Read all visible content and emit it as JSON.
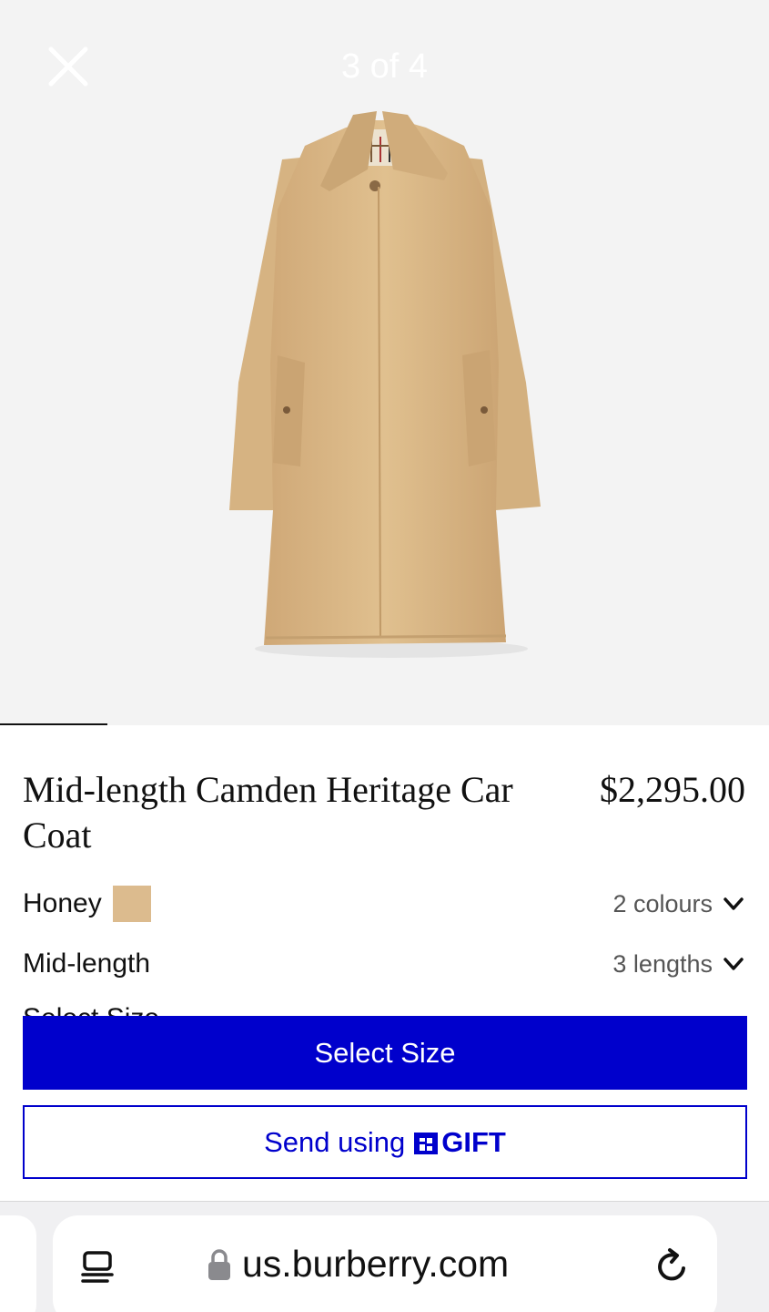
{
  "colors": {
    "accent_blue": "#0000cc",
    "coat": "#d9b888",
    "swatch_honey": "#dcbb8e",
    "gallery_bg": "#f3f3f3"
  },
  "gallery": {
    "counter": "3 of 4",
    "close_icon": "close-x-icon",
    "image_progress": 0.14
  },
  "product": {
    "title": "Mid-length Camden Heritage Car Coat",
    "price": "$2,295.00",
    "colour": {
      "selected": "Honey",
      "options_label": "2 colours",
      "icon": "chevron-down-icon"
    },
    "length": {
      "selected": "Mid-length",
      "options_label": "3 lengths",
      "icon": "chevron-down-icon"
    },
    "partial_heading": "Select Size"
  },
  "actions": {
    "select_size": "Select Size",
    "send_gift_prefix": "Send using",
    "gift_brand": "GIFT"
  },
  "browser": {
    "url": "us.burberry.com",
    "icons": [
      "reader-mode-icon",
      "lock-icon",
      "reload-icon"
    ]
  }
}
